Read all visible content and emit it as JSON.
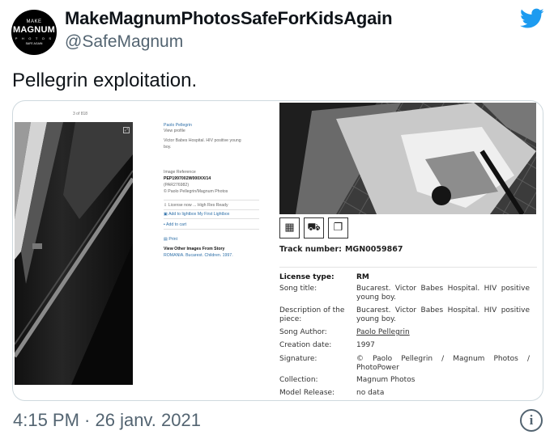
{
  "author": {
    "avatar_lines": [
      "MAKE",
      "MAGNUM",
      "P H O T O S",
      "SAFE AGAIN"
    ],
    "display_name": "MakeMagnumPhotosSafeForKidsAgain",
    "handle": "@SafeMagnum"
  },
  "tweet": {
    "text": "Pellegrin exploitation.",
    "timestamp": "4:15 PM · 26 janv. 2021"
  },
  "icons": {
    "platform": "twitter-bird-icon",
    "info": "info-icon",
    "toolbar": [
      "calculator-icon",
      "cart-icon",
      "copy-icon"
    ]
  },
  "colors": {
    "brand": "#1d9bf0",
    "muted": "#536471",
    "border": "#cfd9de"
  },
  "left_panel": {
    "counter": "3 of 818",
    "photographer": "Paolo Pellegrin",
    "view_profile": "View profile",
    "caption_1": "Victor Babes Hospital. HIV positive young",
    "caption_2": "boy.",
    "image_reference_label": "Image Reference",
    "ref_code": "PEP1997002W000XX/14",
    "ref_alt": "(PAR276982)",
    "copyright": "© Paolo Pellegrin/Magnum Photos",
    "license_label": "License now",
    "license_status": "High Res Ready",
    "add_lightbox": "Add to lightbox My First Lightbox",
    "add_cart": "Add to cart",
    "print": "Print",
    "other_images": "View Other Images From Story",
    "story": "ROMANIA. Bucarest. Children. 1997."
  },
  "right_panel": {
    "track_label": "Track number:",
    "track_number": "MGN0059867",
    "rows": [
      {
        "label": "License type:",
        "value": "RM"
      },
      {
        "label": "Song title:",
        "value": "Bucarest. Victor Babes Hospital. HIV positive young boy."
      },
      {
        "label": "Description of the piece:",
        "value": "Bucarest. Victor Babes Hospital. HIV positive young boy."
      },
      {
        "label": "Song Author:",
        "value": "Paolo Pellegrin"
      },
      {
        "label": "Creation date:",
        "value": "1997"
      },
      {
        "label": "Signature:",
        "value": "© Paolo Pellegrin / Magnum Photos / PhotoPower"
      },
      {
        "label": "Collection:",
        "value": "Magnum Photos"
      },
      {
        "label": "Model Release:",
        "value": "no data"
      }
    ]
  }
}
